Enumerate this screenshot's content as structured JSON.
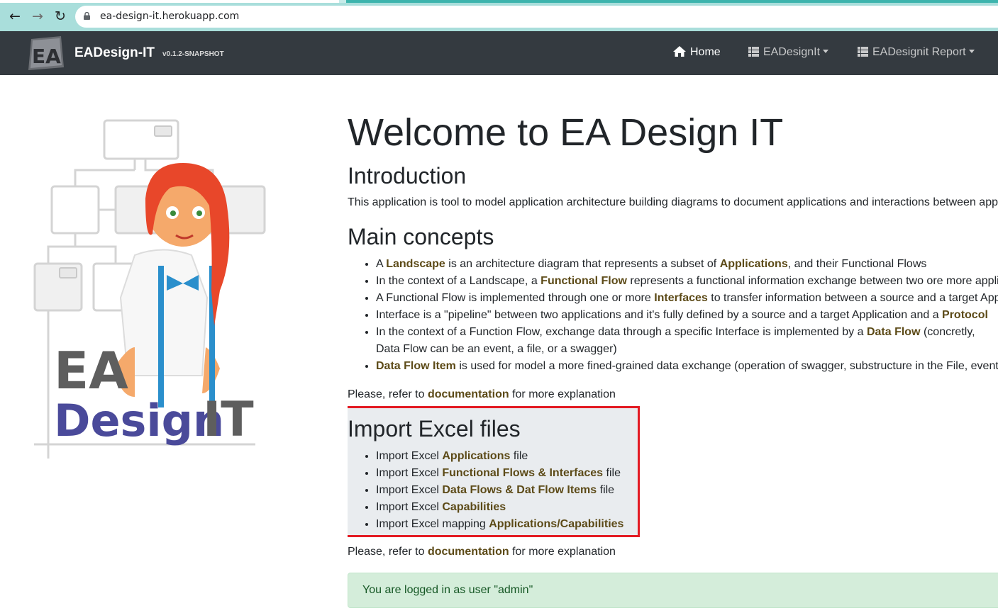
{
  "browser": {
    "url": "ea-design-it.herokuapp.com",
    "back_icon": "arrow-left",
    "forward_icon": "arrow-right",
    "reload_icon": "reload"
  },
  "navbar": {
    "brand": "EADesign-IT",
    "version": "v0.1.2-SNAPSHOT",
    "home_label": "Home",
    "eadesignit_label": "EADesignIt",
    "report_label": "EADesignit Report"
  },
  "illustration": {
    "word_ea": "EA",
    "word_design": "Design",
    "word_it": "IT"
  },
  "main": {
    "title": "Welcome to EA Design IT",
    "intro_title": "Introduction",
    "intro_text": "This application is tool to model application architecture building diagrams to document applications and interactions between applications",
    "concepts_title": "Main concepts",
    "concepts": [
      {
        "p1": "A ",
        "l1": "Landscape",
        "p2": " is an architecture diagram that represents a subset of ",
        "l2": "Applications",
        "p3": ", and their Functional Flows"
      },
      {
        "p1": "In the context of a Landscape, a ",
        "l1": "Functional Flow",
        "p2": " represents a functional information exchange between two ore more applications"
      },
      {
        "p1": "A Functional Flow is implemented through one or more ",
        "l1": "Interfaces",
        "p2": " to transfer information between a source and a target Application"
      },
      {
        "p1": "Interface is a \"pipeline\" between two applications and it's fully defined by a source and a target Application and a ",
        "l1": "Protocol",
        "p2": ""
      },
      {
        "p1": "In the context of a Function Flow, exchange data through a specific Interface is implemented by a ",
        "l1": "Data Flow",
        "p2": " (concretly, Data Flow can be an event, a file, or a swagger)"
      },
      {
        "p1": "",
        "l1": "Data Flow Item",
        "p2": " is used for model a more fined-grained data exchange (operation of swagger, substructure in the File, event, ...)"
      }
    ],
    "refer_prefix": "Please, refer to ",
    "refer_link": "documentation",
    "refer_suffix": " for more explanation"
  },
  "imports": {
    "title": "Import Excel files",
    "items": [
      {
        "p1": "Import Excel ",
        "l1": "Applications",
        "p2": " file"
      },
      {
        "p1": "Import Excel ",
        "l1": "Functional Flows & Interfaces",
        "p2": " file"
      },
      {
        "p1": "Import Excel ",
        "l1": "Data Flows & Dat Flow Items",
        "p2": " file"
      },
      {
        "p1": "Import Excel ",
        "l1": "Capabilities",
        "p2": ""
      },
      {
        "p1": "Import Excel mapping ",
        "l1": "Applications/Capabilities",
        "p2": ""
      }
    ]
  },
  "alert": {
    "text": "You are logged in as user \"admin\""
  },
  "colors": {
    "navbar": "#343a40",
    "link": "#5c4a17",
    "highlight_border": "#e31b23",
    "alert_bg": "#d4edda",
    "alert_text": "#155724"
  }
}
